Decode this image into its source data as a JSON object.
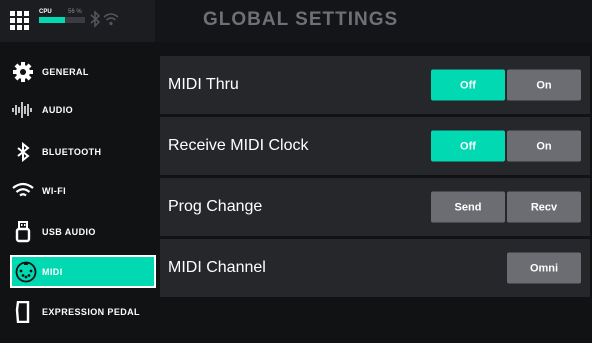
{
  "header": {
    "title": "GLOBAL SETTINGS",
    "menu_icon": "grid-icon",
    "cpu": {
      "label": "CPU",
      "percent_text": "56 %",
      "level": 0.56
    },
    "status_icons": [
      "bluetooth-icon",
      "wifi-icon"
    ]
  },
  "sidebar": {
    "items": [
      {
        "label": "GENERAL",
        "icon": "gear-icon",
        "active": false
      },
      {
        "label": "AUDIO",
        "icon": "waveform-icon",
        "active": false
      },
      {
        "label": "BLUETOOTH",
        "icon": "bluetooth-icon",
        "active": false
      },
      {
        "label": "WI-FI",
        "icon": "wifi-icon",
        "active": false
      },
      {
        "label": "USB AUDIO",
        "icon": "usb-icon",
        "active": false
      },
      {
        "label": "MIDI",
        "icon": "midi-connector-icon",
        "active": true
      },
      {
        "label": "EXPRESSION PEDAL",
        "icon": "pedal-icon",
        "active": false
      }
    ]
  },
  "settings": [
    {
      "label": "MIDI Thru",
      "options": [
        "Off",
        "On"
      ],
      "selected": "Off"
    },
    {
      "label": "Receive MIDI Clock",
      "options": [
        "Off",
        "On"
      ],
      "selected": "Off"
    },
    {
      "label": "Prog Change",
      "options": [
        "Send",
        "Recv"
      ],
      "selected": ""
    },
    {
      "label": "MIDI Channel",
      "options": [
        "Omni"
      ],
      "selected": ""
    }
  ],
  "colors": {
    "accent": "#00d9b2",
    "button_inactive": "#6b6d72",
    "row_bg": "#26272b",
    "title": "#6e7076"
  }
}
